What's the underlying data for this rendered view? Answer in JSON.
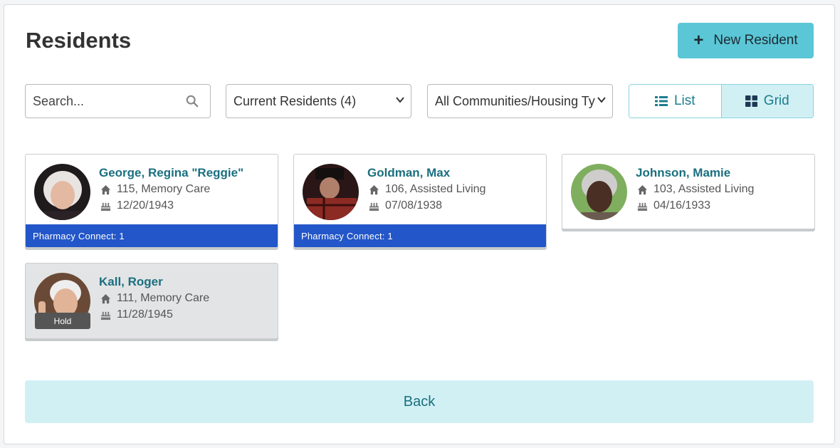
{
  "page": {
    "title": "Residents"
  },
  "toolbar": {
    "new_resident_label": "New Resident"
  },
  "filters": {
    "search_placeholder": "Search...",
    "status_selected": "Current Residents (4)",
    "community_selected": "All Communities/Housing Types"
  },
  "view_toggle": {
    "list_label": "List",
    "grid_label": "Grid",
    "active": "Grid"
  },
  "residents": [
    {
      "name": "George, Regina \"Reggie\"",
      "unit": "115, Memory Care",
      "dob": "12/20/1943",
      "pharmacy": "Pharmacy Connect: 1",
      "hold": ""
    },
    {
      "name": "Goldman, Max",
      "unit": "106, Assisted Living",
      "dob": "07/08/1938",
      "pharmacy": "Pharmacy Connect: 1",
      "hold": ""
    },
    {
      "name": "Johnson, Mamie",
      "unit": "103, Assisted Living",
      "dob": "04/16/1933",
      "pharmacy": "",
      "hold": ""
    },
    {
      "name": "Kall, Roger",
      "unit": "111, Memory Care",
      "dob": "11/28/1945",
      "pharmacy": "",
      "hold": "Hold"
    }
  ],
  "footer": {
    "back_label": "Back"
  },
  "colors": {
    "accent": "#5bc6d6",
    "link": "#1a6f80",
    "pharmacy_bar": "#2356c8",
    "back_bg": "#d1f0f4"
  }
}
